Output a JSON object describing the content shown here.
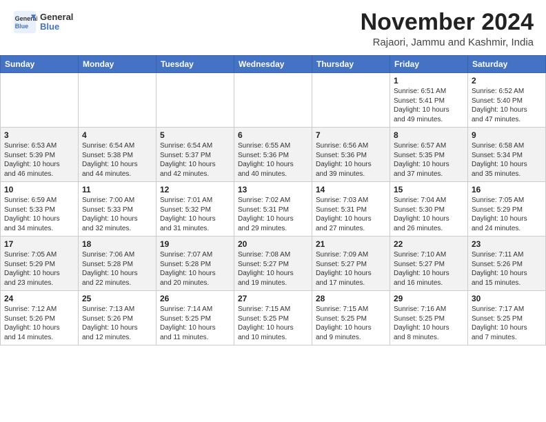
{
  "header": {
    "logo_line1": "General",
    "logo_line2": "Blue",
    "month": "November 2024",
    "location": "Rajaori, Jammu and Kashmir, India"
  },
  "weekdays": [
    "Sunday",
    "Monday",
    "Tuesday",
    "Wednesday",
    "Thursday",
    "Friday",
    "Saturday"
  ],
  "weeks": [
    [
      {
        "day": "",
        "info": ""
      },
      {
        "day": "",
        "info": ""
      },
      {
        "day": "",
        "info": ""
      },
      {
        "day": "",
        "info": ""
      },
      {
        "day": "",
        "info": ""
      },
      {
        "day": "1",
        "info": "Sunrise: 6:51 AM\nSunset: 5:41 PM\nDaylight: 10 hours\nand 49 minutes."
      },
      {
        "day": "2",
        "info": "Sunrise: 6:52 AM\nSunset: 5:40 PM\nDaylight: 10 hours\nand 47 minutes."
      }
    ],
    [
      {
        "day": "3",
        "info": "Sunrise: 6:53 AM\nSunset: 5:39 PM\nDaylight: 10 hours\nand 46 minutes."
      },
      {
        "day": "4",
        "info": "Sunrise: 6:54 AM\nSunset: 5:38 PM\nDaylight: 10 hours\nand 44 minutes."
      },
      {
        "day": "5",
        "info": "Sunrise: 6:54 AM\nSunset: 5:37 PM\nDaylight: 10 hours\nand 42 minutes."
      },
      {
        "day": "6",
        "info": "Sunrise: 6:55 AM\nSunset: 5:36 PM\nDaylight: 10 hours\nand 40 minutes."
      },
      {
        "day": "7",
        "info": "Sunrise: 6:56 AM\nSunset: 5:36 PM\nDaylight: 10 hours\nand 39 minutes."
      },
      {
        "day": "8",
        "info": "Sunrise: 6:57 AM\nSunset: 5:35 PM\nDaylight: 10 hours\nand 37 minutes."
      },
      {
        "day": "9",
        "info": "Sunrise: 6:58 AM\nSunset: 5:34 PM\nDaylight: 10 hours\nand 35 minutes."
      }
    ],
    [
      {
        "day": "10",
        "info": "Sunrise: 6:59 AM\nSunset: 5:33 PM\nDaylight: 10 hours\nand 34 minutes."
      },
      {
        "day": "11",
        "info": "Sunrise: 7:00 AM\nSunset: 5:33 PM\nDaylight: 10 hours\nand 32 minutes."
      },
      {
        "day": "12",
        "info": "Sunrise: 7:01 AM\nSunset: 5:32 PM\nDaylight: 10 hours\nand 31 minutes."
      },
      {
        "day": "13",
        "info": "Sunrise: 7:02 AM\nSunset: 5:31 PM\nDaylight: 10 hours\nand 29 minutes."
      },
      {
        "day": "14",
        "info": "Sunrise: 7:03 AM\nSunset: 5:31 PM\nDaylight: 10 hours\nand 27 minutes."
      },
      {
        "day": "15",
        "info": "Sunrise: 7:04 AM\nSunset: 5:30 PM\nDaylight: 10 hours\nand 26 minutes."
      },
      {
        "day": "16",
        "info": "Sunrise: 7:05 AM\nSunset: 5:29 PM\nDaylight: 10 hours\nand 24 minutes."
      }
    ],
    [
      {
        "day": "17",
        "info": "Sunrise: 7:05 AM\nSunset: 5:29 PM\nDaylight: 10 hours\nand 23 minutes."
      },
      {
        "day": "18",
        "info": "Sunrise: 7:06 AM\nSunset: 5:28 PM\nDaylight: 10 hours\nand 22 minutes."
      },
      {
        "day": "19",
        "info": "Sunrise: 7:07 AM\nSunset: 5:28 PM\nDaylight: 10 hours\nand 20 minutes."
      },
      {
        "day": "20",
        "info": "Sunrise: 7:08 AM\nSunset: 5:27 PM\nDaylight: 10 hours\nand 19 minutes."
      },
      {
        "day": "21",
        "info": "Sunrise: 7:09 AM\nSunset: 5:27 PM\nDaylight: 10 hours\nand 17 minutes."
      },
      {
        "day": "22",
        "info": "Sunrise: 7:10 AM\nSunset: 5:27 PM\nDaylight: 10 hours\nand 16 minutes."
      },
      {
        "day": "23",
        "info": "Sunrise: 7:11 AM\nSunset: 5:26 PM\nDaylight: 10 hours\nand 15 minutes."
      }
    ],
    [
      {
        "day": "24",
        "info": "Sunrise: 7:12 AM\nSunset: 5:26 PM\nDaylight: 10 hours\nand 14 minutes."
      },
      {
        "day": "25",
        "info": "Sunrise: 7:13 AM\nSunset: 5:26 PM\nDaylight: 10 hours\nand 12 minutes."
      },
      {
        "day": "26",
        "info": "Sunrise: 7:14 AM\nSunset: 5:25 PM\nDaylight: 10 hours\nand 11 minutes."
      },
      {
        "day": "27",
        "info": "Sunrise: 7:15 AM\nSunset: 5:25 PM\nDaylight: 10 hours\nand 10 minutes."
      },
      {
        "day": "28",
        "info": "Sunrise: 7:15 AM\nSunset: 5:25 PM\nDaylight: 10 hours\nand 9 minutes."
      },
      {
        "day": "29",
        "info": "Sunrise: 7:16 AM\nSunset: 5:25 PM\nDaylight: 10 hours\nand 8 minutes."
      },
      {
        "day": "30",
        "info": "Sunrise: 7:17 AM\nSunset: 5:25 PM\nDaylight: 10 hours\nand 7 minutes."
      }
    ]
  ]
}
